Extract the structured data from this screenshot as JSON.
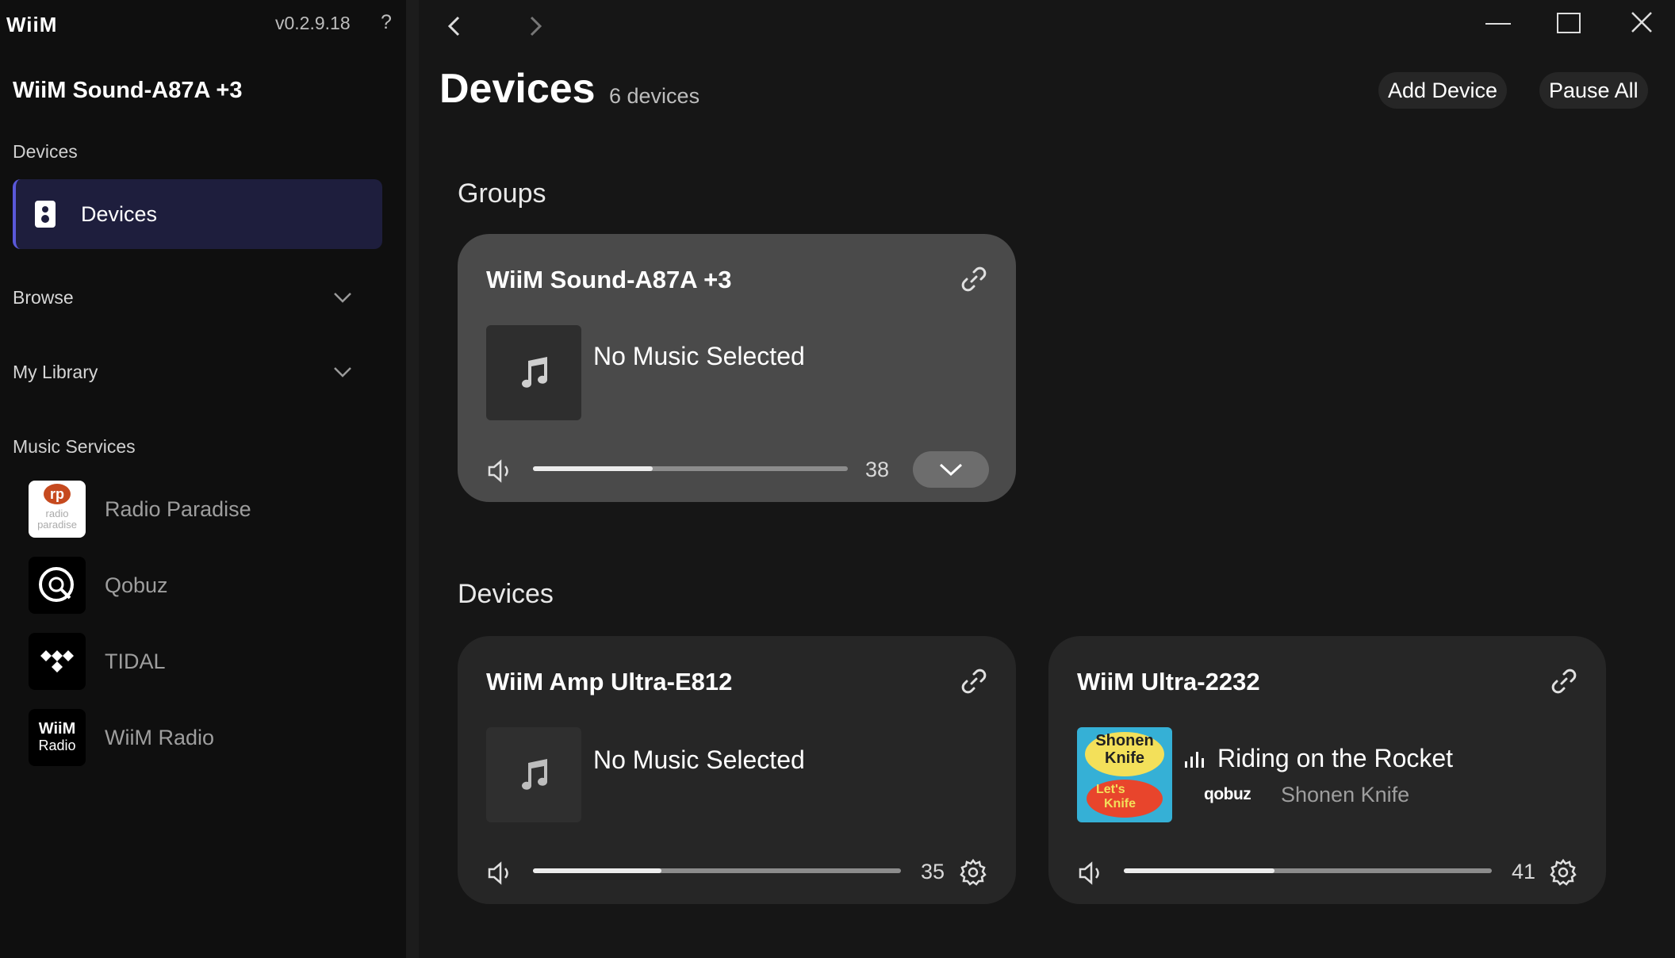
{
  "app": {
    "logo": "WiiM",
    "version": "v0.2.9.18",
    "help": "?"
  },
  "sidebar": {
    "current_group": "WiiM Sound-A87A +3",
    "devices_section": "Devices",
    "devices_item": "Devices",
    "browse": "Browse",
    "my_library": "My Library",
    "music_services_section": "Music Services",
    "services": [
      {
        "name": "Radio Paradise",
        "logo_text": "rp",
        "logo_sub1": "radio",
        "logo_sub2": "paradise"
      },
      {
        "name": "Qobuz"
      },
      {
        "name": "TIDAL"
      },
      {
        "name": "WiiM Radio",
        "logo_text": "WiiM",
        "logo_sub": "Radio"
      }
    ]
  },
  "header": {
    "title": "Devices",
    "count": "6 devices",
    "add_device": "Add Device",
    "pause_all": "Pause All"
  },
  "groups_heading": "Groups",
  "devices_heading": "Devices",
  "group_card": {
    "name": "WiiM Sound-A87A +3",
    "track": "No Music Selected",
    "volume": "38",
    "volume_level": 38
  },
  "device_cards": [
    {
      "name": "WiiM Amp Ultra-E812",
      "track": "No Music Selected",
      "volume": "35",
      "volume_level": 35
    },
    {
      "name": "WiiM Ultra-2232",
      "track": "Riding on the Rocket",
      "service": "qobuz",
      "artist": "Shonen Knife",
      "volume": "41",
      "volume_level": 41,
      "art_text1": "Shonen",
      "art_text2": "Knife",
      "art_text3": "Let's",
      "art_text4": "Knife"
    }
  ],
  "colors": {
    "accent": "#5a58d9",
    "active_bg": "#1e1e3d",
    "group_card": "#4a4a4a",
    "device_card": "#262626"
  }
}
